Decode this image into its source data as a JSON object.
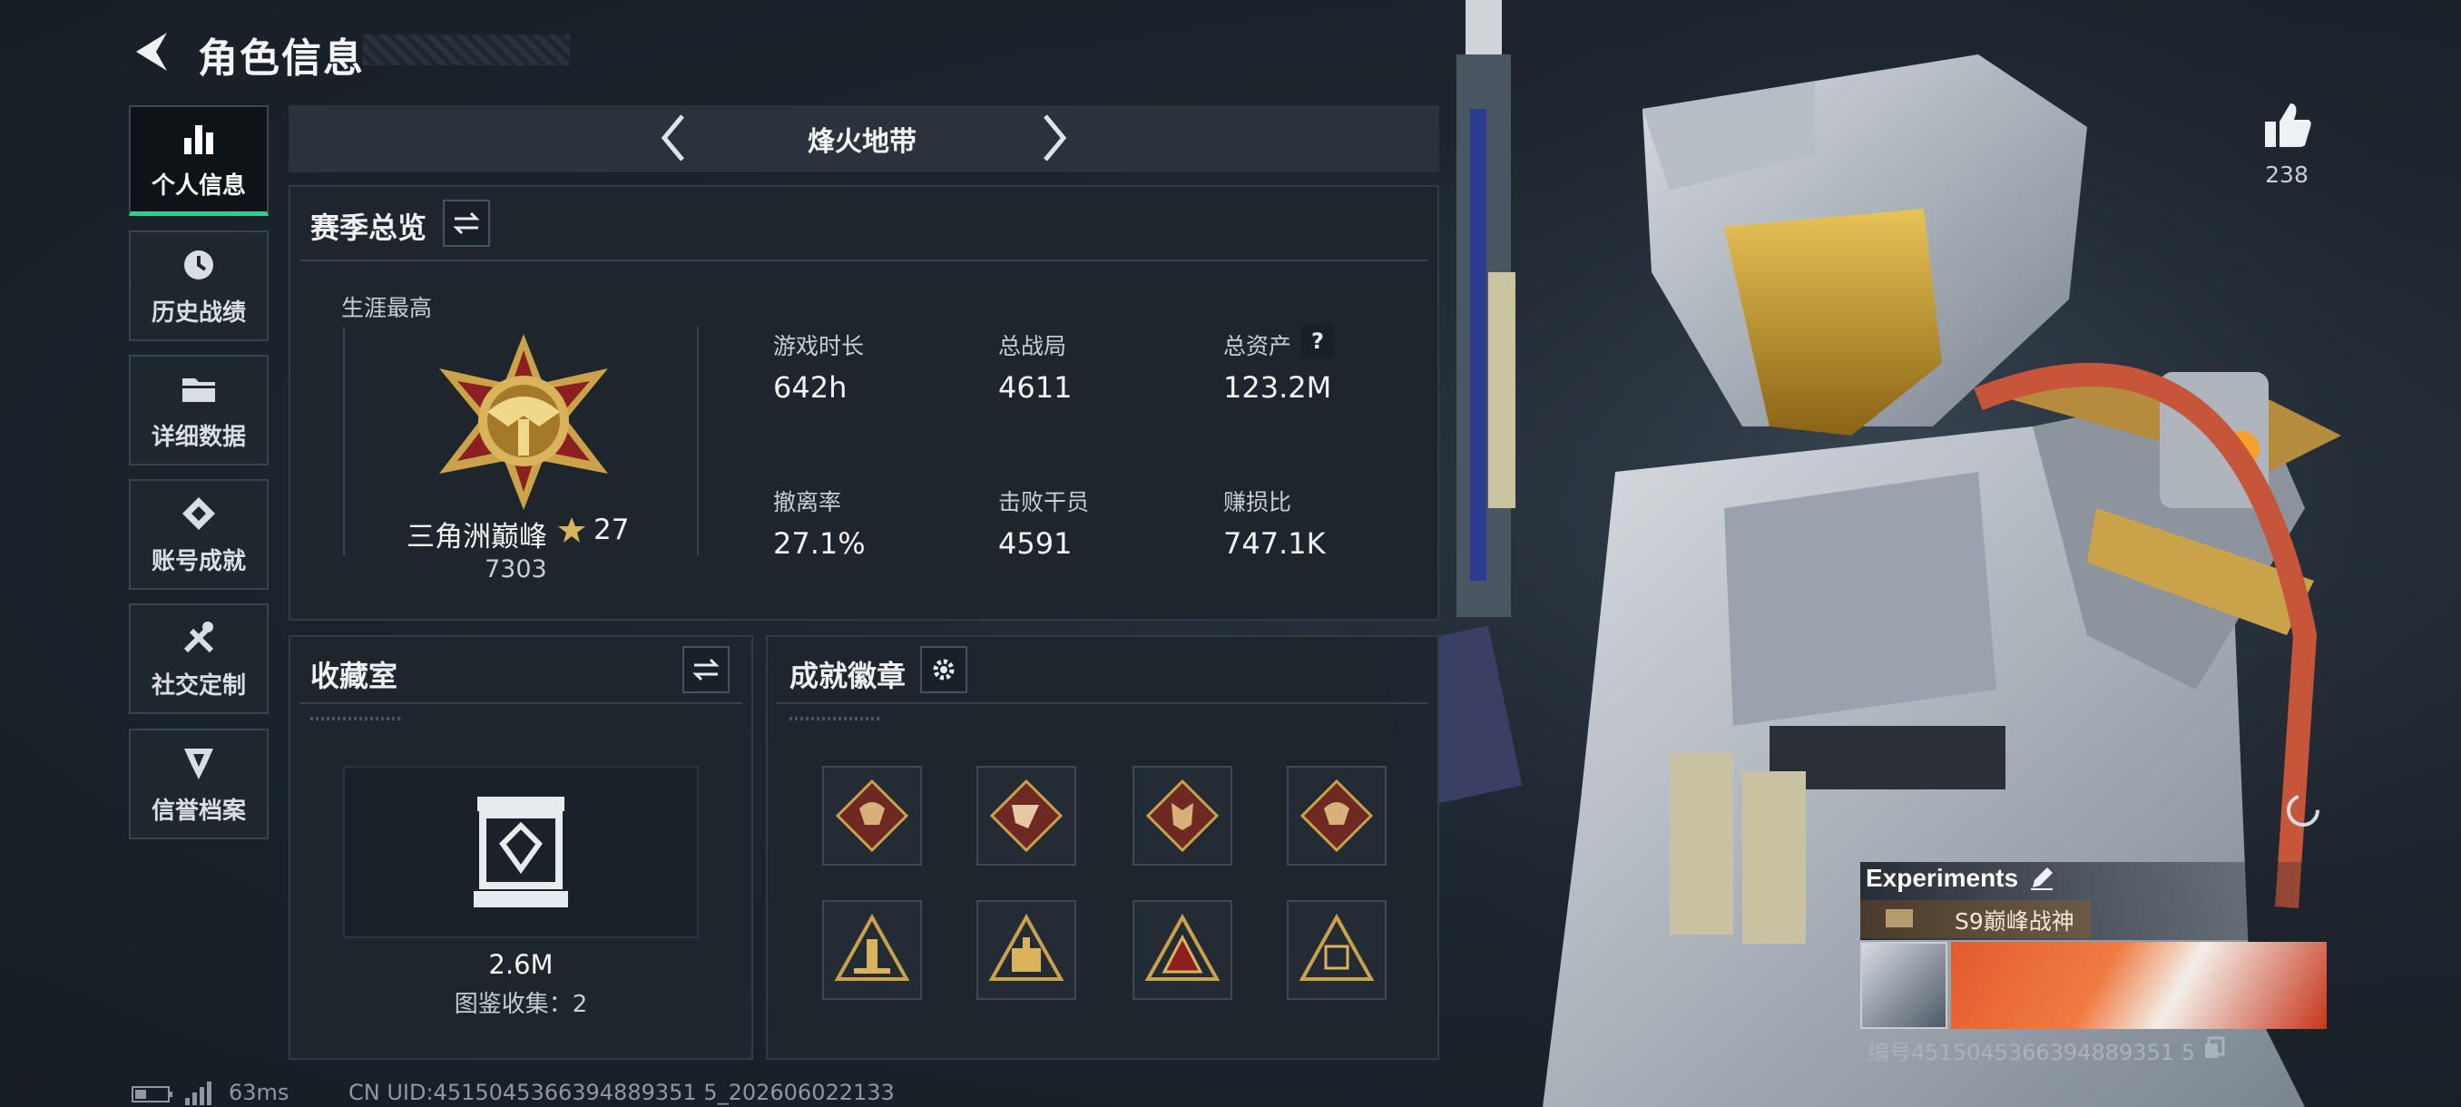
{
  "header": {
    "title": "角色信息"
  },
  "sidebar": {
    "items": [
      {
        "label": "个人信息",
        "icon": "bar-chart-icon",
        "active": true
      },
      {
        "label": "历史战绩",
        "icon": "history-icon",
        "active": false
      },
      {
        "label": "详细数据",
        "icon": "folder-icon",
        "active": false
      },
      {
        "label": "账号成就",
        "icon": "achievement-icon",
        "active": false
      },
      {
        "label": "社交定制",
        "icon": "tools-icon",
        "active": false
      },
      {
        "label": "信誉档案",
        "icon": "credit-icon",
        "active": false
      }
    ]
  },
  "mode": {
    "title": "烽火地带"
  },
  "season": {
    "title": "赛季总览",
    "career_label": "生涯最高",
    "rank_name": "三角洲巅峰",
    "rank_stars": "27",
    "rank_score": "7303",
    "stats": [
      {
        "label": "游戏时长",
        "value": "642h"
      },
      {
        "label": "总战局",
        "value": "4611"
      },
      {
        "label": "总资产",
        "value": "123.2M"
      },
      {
        "label": "撤离率",
        "value": "27.1%"
      },
      {
        "label": "击败干员",
        "value": "4591"
      },
      {
        "label": "赚损比",
        "value": "747.1K"
      }
    ],
    "help_mark": "?"
  },
  "collection": {
    "title": "收藏室",
    "value": "2.6M",
    "subtitle": "图鉴收集：2"
  },
  "badges": {
    "title": "成就徽章",
    "count": 8
  },
  "profile": {
    "likes": "238",
    "name": "Experiments",
    "tag": "S9巅峰战神",
    "id_text": "编号4515045366394889351 5"
  },
  "status_bar": {
    "ping": "63ms",
    "uid": "CN UID:4515045366394889351 5_202606022133"
  },
  "colors": {
    "accent": "#2fcf8a",
    "gold": "#c9a24a",
    "badge_red": "#6e2a22"
  }
}
